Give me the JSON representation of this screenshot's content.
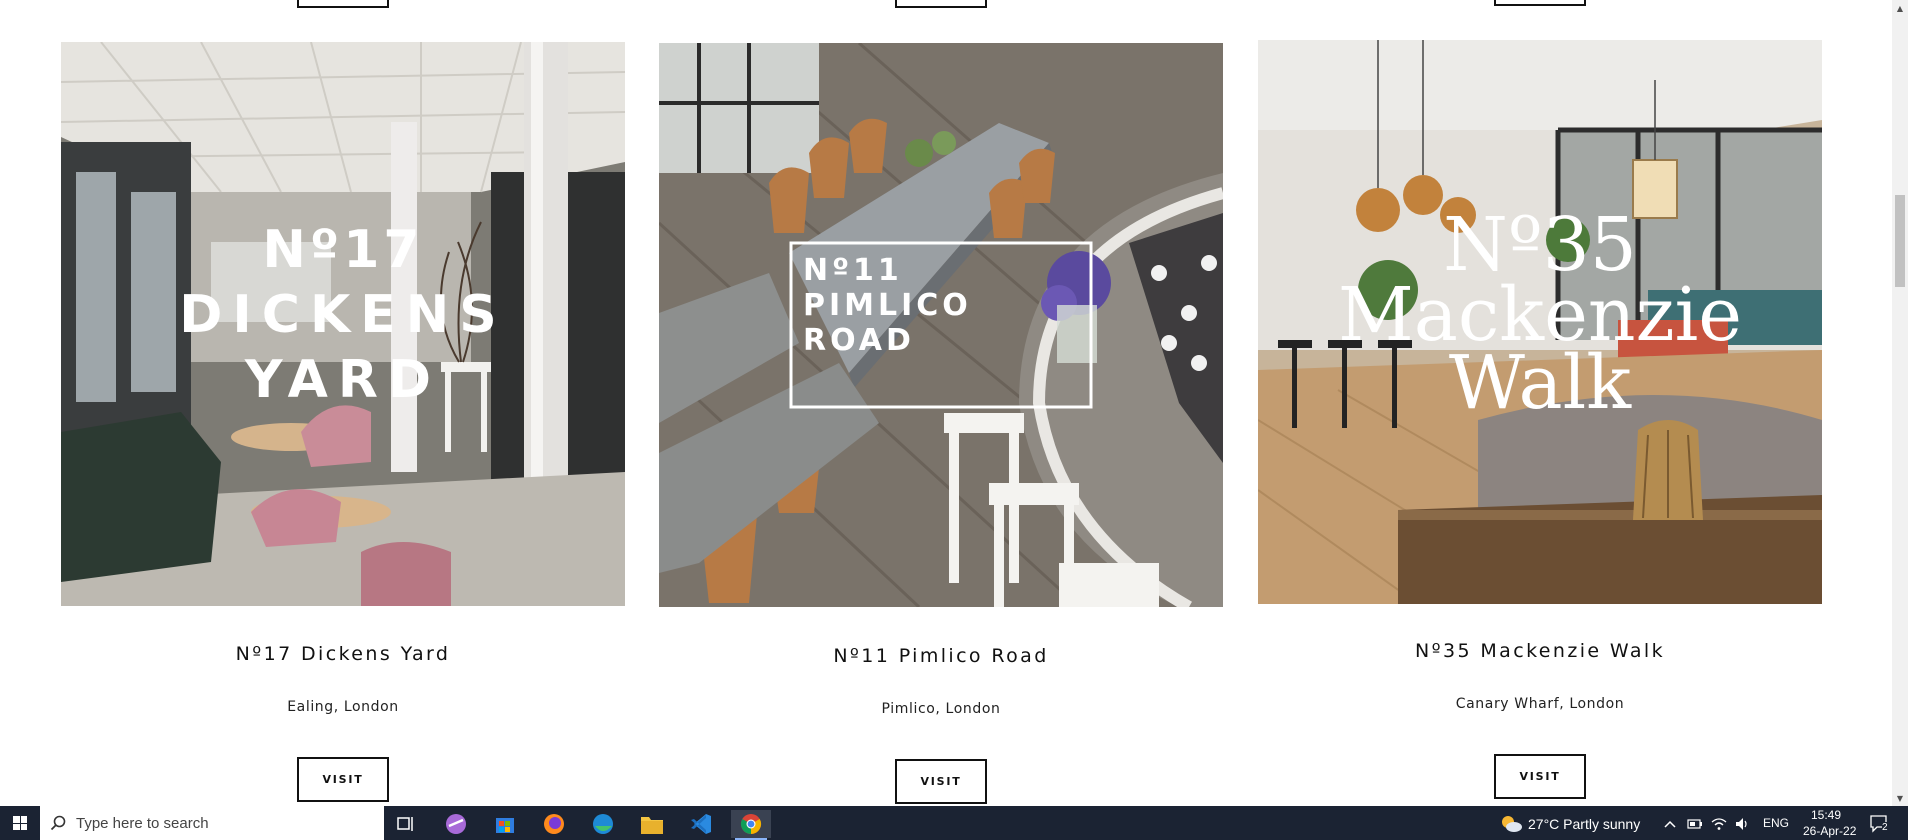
{
  "cards": [
    {
      "id": "dickens",
      "overlay": [
        "Nº17",
        "DICKENS",
        "YARD"
      ],
      "title": "Nº17 Dickens Yard",
      "location": "Ealing, London",
      "button": "VISIT"
    },
    {
      "id": "pimlico",
      "overlay": [
        "Nº11",
        "PIMLICO",
        "ROAD"
      ],
      "title": "Nº11 Pimlico Road",
      "location": "Pimlico, London",
      "button": "VISIT"
    },
    {
      "id": "mackenzie",
      "overlay": [
        "Nº35",
        "Mackenzie",
        "Walk"
      ],
      "title": "Nº35 Mackenzie Walk",
      "location": "Canary Wharf, London",
      "button": "VISIT"
    }
  ],
  "scrollbar": {
    "up": "▲",
    "down": "▼"
  },
  "taskbar": {
    "search_placeholder": "Type here to search",
    "weather": "27°C  Partly sunny",
    "language": "ENG",
    "time": "15:49",
    "date": "26-Apr-22",
    "notification_count": "2"
  },
  "colors": {
    "taskbar_bg": "#1b2333",
    "text": "#111111",
    "button_border": "#111111"
  }
}
